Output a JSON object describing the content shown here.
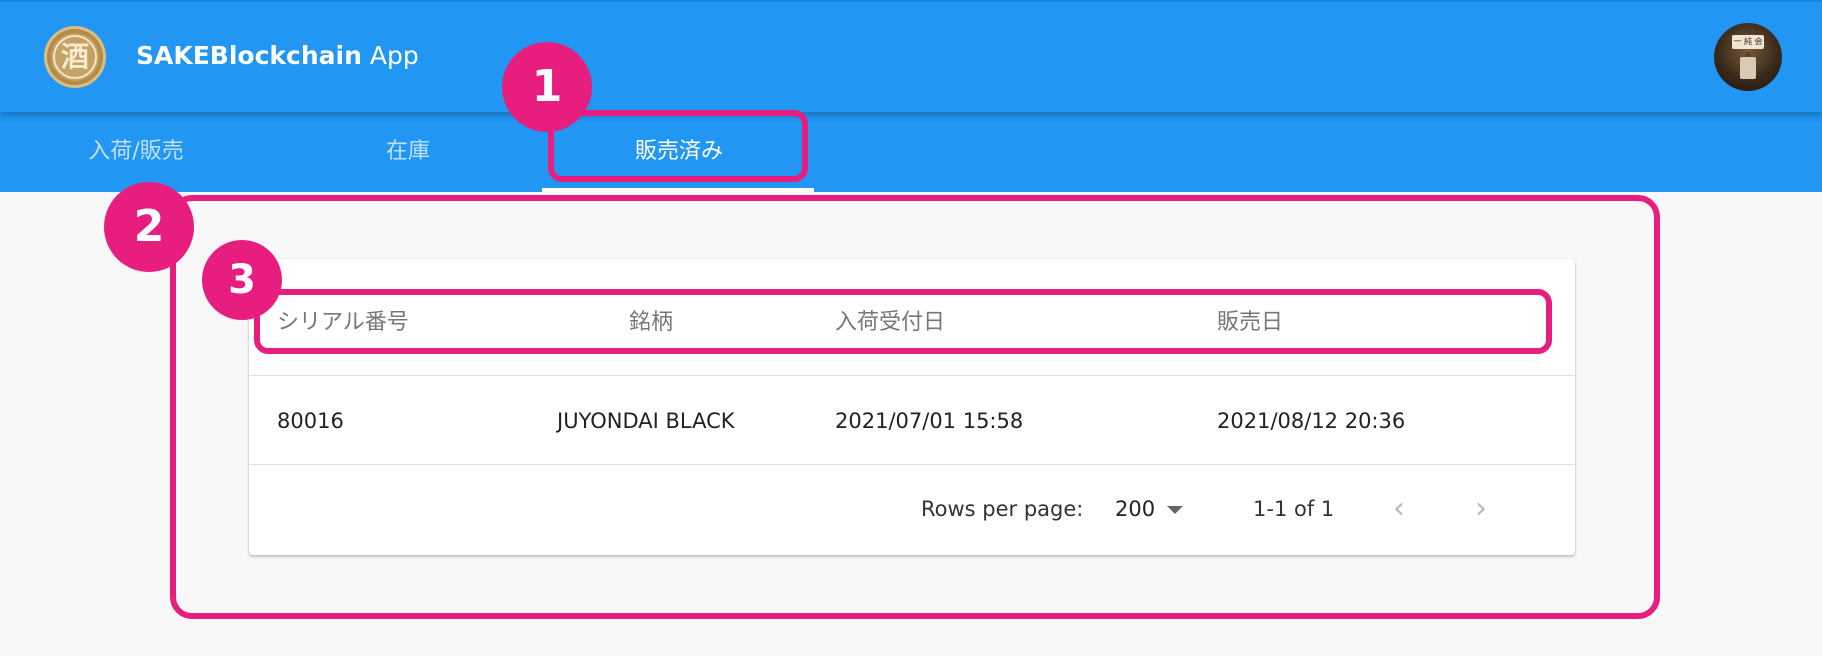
{
  "app": {
    "title_bold": "SAKEBlockchain",
    "title_light": "App",
    "logo_glyph": "酒",
    "avatar_sign": "一 純 会 る",
    "colors": {
      "appbar": "#2196f3",
      "annotation": "#e81e7f",
      "background": "#f8f8f8"
    }
  },
  "tabs": [
    {
      "label": "入荷/販売",
      "active": false
    },
    {
      "label": "在庫",
      "active": false
    },
    {
      "label": "販売済み",
      "active": true
    }
  ],
  "table": {
    "headers": [
      "シリアル番号",
      "銘柄",
      "入荷受付日",
      "販売日"
    ],
    "rows": [
      [
        "80016",
        "JUYONDAI BLACK",
        "2021/07/01 15:58",
        "2021/08/12 20:36"
      ]
    ]
  },
  "pagination": {
    "rows_per_page_label": "Rows per page:",
    "rows_per_page_value": "200",
    "range": "1-1 of 1",
    "prev_icon": "‹",
    "next_icon": "›"
  },
  "annotations": [
    "1",
    "2",
    "3"
  ]
}
